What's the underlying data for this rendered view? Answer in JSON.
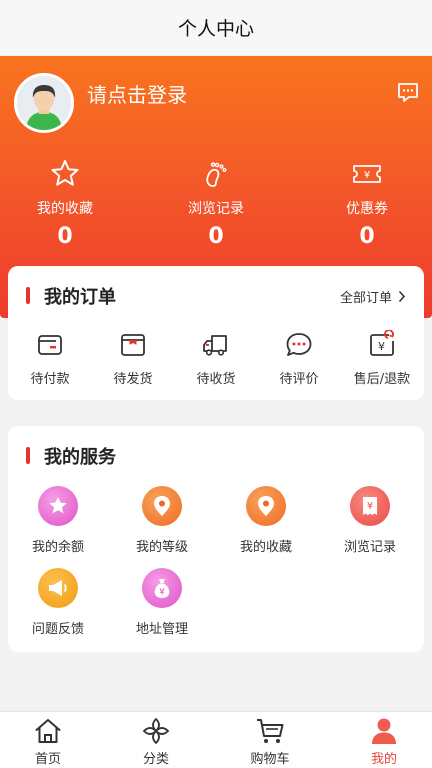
{
  "header": {
    "title": "个人中心"
  },
  "profile": {
    "login_text": "请点击登录",
    "message_icon": "message-icon"
  },
  "stats": [
    {
      "label": "我的收藏",
      "value": "0",
      "icon": "star-icon"
    },
    {
      "label": "浏览记录",
      "value": "0",
      "icon": "footprint-icon"
    },
    {
      "label": "优惠券",
      "value": "0",
      "icon": "coupon-icon"
    }
  ],
  "orders": {
    "title": "我的订单",
    "all_label": "全部订单",
    "items": [
      {
        "label": "待付款",
        "icon": "wallet-icon"
      },
      {
        "label": "待发货",
        "icon": "box-icon"
      },
      {
        "label": "待收货",
        "icon": "truck-icon"
      },
      {
        "label": "待评价",
        "icon": "comment-icon"
      },
      {
        "label": "售后/退款",
        "icon": "refund-icon"
      }
    ]
  },
  "services": {
    "title": "我的服务",
    "items": [
      {
        "label": "我的余额",
        "icon": "star-badge-icon",
        "color": "#e85bd0"
      },
      {
        "label": "我的等级",
        "icon": "location-pin-icon",
        "color": "#f27a32"
      },
      {
        "label": "我的收藏",
        "icon": "location-pin-icon",
        "color": "#f27a32"
      },
      {
        "label": "浏览记录",
        "icon": "receipt-icon",
        "color": "#ef5a52"
      },
      {
        "label": "问题反馈",
        "icon": "megaphone-icon",
        "color": "#f6a21c"
      },
      {
        "label": "地址管理",
        "icon": "money-bag-icon",
        "color": "#ea5bcc"
      }
    ]
  },
  "tabbar": {
    "items": [
      {
        "label": "首页",
        "icon": "home-icon"
      },
      {
        "label": "分类",
        "icon": "category-icon"
      },
      {
        "label": "购物车",
        "icon": "cart-icon"
      },
      {
        "label": "我的",
        "icon": "user-icon"
      }
    ],
    "active_color": "#e8453b"
  }
}
